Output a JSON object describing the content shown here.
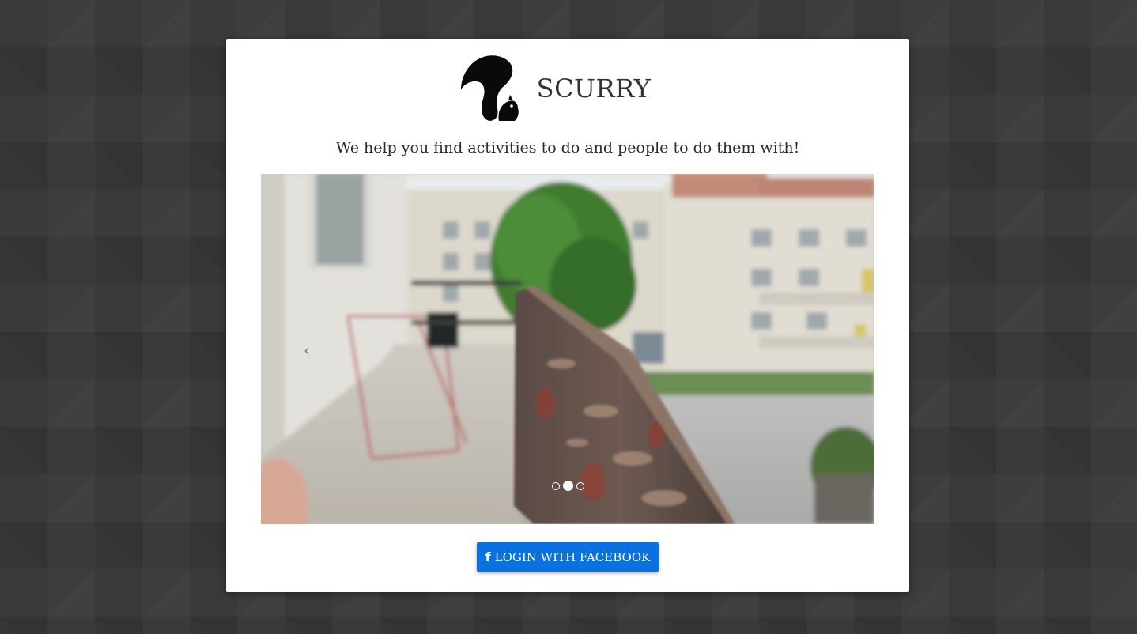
{
  "app": {
    "name": "SCURRY",
    "logo_icon": "squirrel-logo-icon",
    "tagline": "We help you find activities to do and people to do them with!"
  },
  "carousel": {
    "prev_icon": "chevron-left-icon",
    "prev_glyph": "‹",
    "slide_count": 3,
    "active_index": 1
  },
  "login": {
    "button_icon": "facebook-icon",
    "icon_glyph": "f",
    "button_label": "LOGIN WITH FACEBOOK"
  },
  "colors": {
    "button_bg": "#0a72e0",
    "modal_bg": "#ffffff",
    "page_bg": "#3a3a3a"
  }
}
